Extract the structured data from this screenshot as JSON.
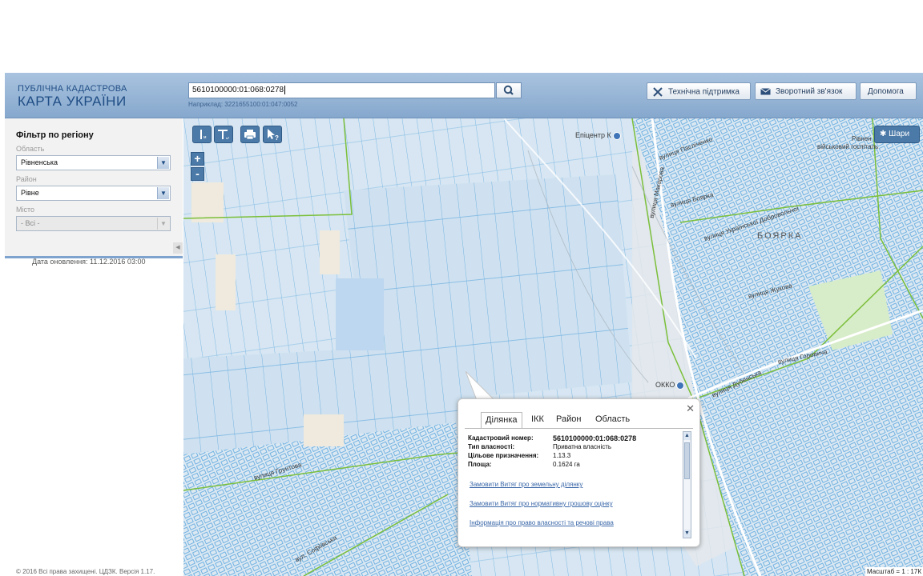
{
  "header": {
    "title_line1": "ПУБЛІЧНА КАДАСТРОВА",
    "title_line2": "КАРТА УКРАЇНИ",
    "search_value": "5610100000:01:068:0278",
    "search_example": "Наприклад: 3221655100:01:047:0052",
    "buttons": {
      "support": "Технічна підтримка",
      "feedback": "Зворотний зв'язок",
      "help": "Допомога"
    }
  },
  "sidebar": {
    "title": "Фільтр по регіону",
    "oblast_label": "Область",
    "oblast_value": "Рівненська",
    "raion_label": "Район",
    "raion_value": "Рівне",
    "city_label": "Місто",
    "city_value": "- Всі -",
    "update_date": "Дата оновлення: 11.12.2016 03:00",
    "copyright": "© 2016 Всі права захищені. ЦДЗК. Версія 1.17."
  },
  "map": {
    "layers_label": "Шари",
    "zoom_in": "+",
    "zoom_out": "-",
    "labels": {
      "epicenter": "Епіцентр К",
      "okko": "ОККО",
      "boyarka": "БОЯРКА",
      "rivne_hospital_1": "Рівнен",
      "rivne_hospital_2": "військовий госпіталь"
    },
    "streets": {
      "paslichenko": "вулиця Пасліченко",
      "makarova": "вулиця Макарова",
      "boyarka_st": "вулиця Боярка",
      "dobrovolchoi": "вулиця Української Добровольчої",
      "zhukova": "вулиця Жукова",
      "dubenska": "вулиця Дубенська",
      "gorovycha": "вулиця Горовича",
      "hruntova": "вулиця Грунтова",
      "sofiivska": "вул. Софіївська"
    },
    "scale": "Масштаб = 1 : 17К"
  },
  "popup": {
    "tabs": [
      "Ділянка",
      "ІКК",
      "Район",
      "Область"
    ],
    "active_tab": 0,
    "fields": [
      {
        "key": "Кадастровий номер:",
        "value": "5610100000:01:068:0278"
      },
      {
        "key": "Тип власності:",
        "value": "Приватна власність"
      },
      {
        "key": "Цільове призначення:",
        "value": "1.13.3"
      },
      {
        "key": "Площа:",
        "value": "0.1624 га"
      }
    ],
    "links": [
      "Замовити Витяг про земельну ділянку",
      "Замовити Витяг про нормативну грошову оцінку",
      "Інформація про право власності та речові права"
    ]
  }
}
